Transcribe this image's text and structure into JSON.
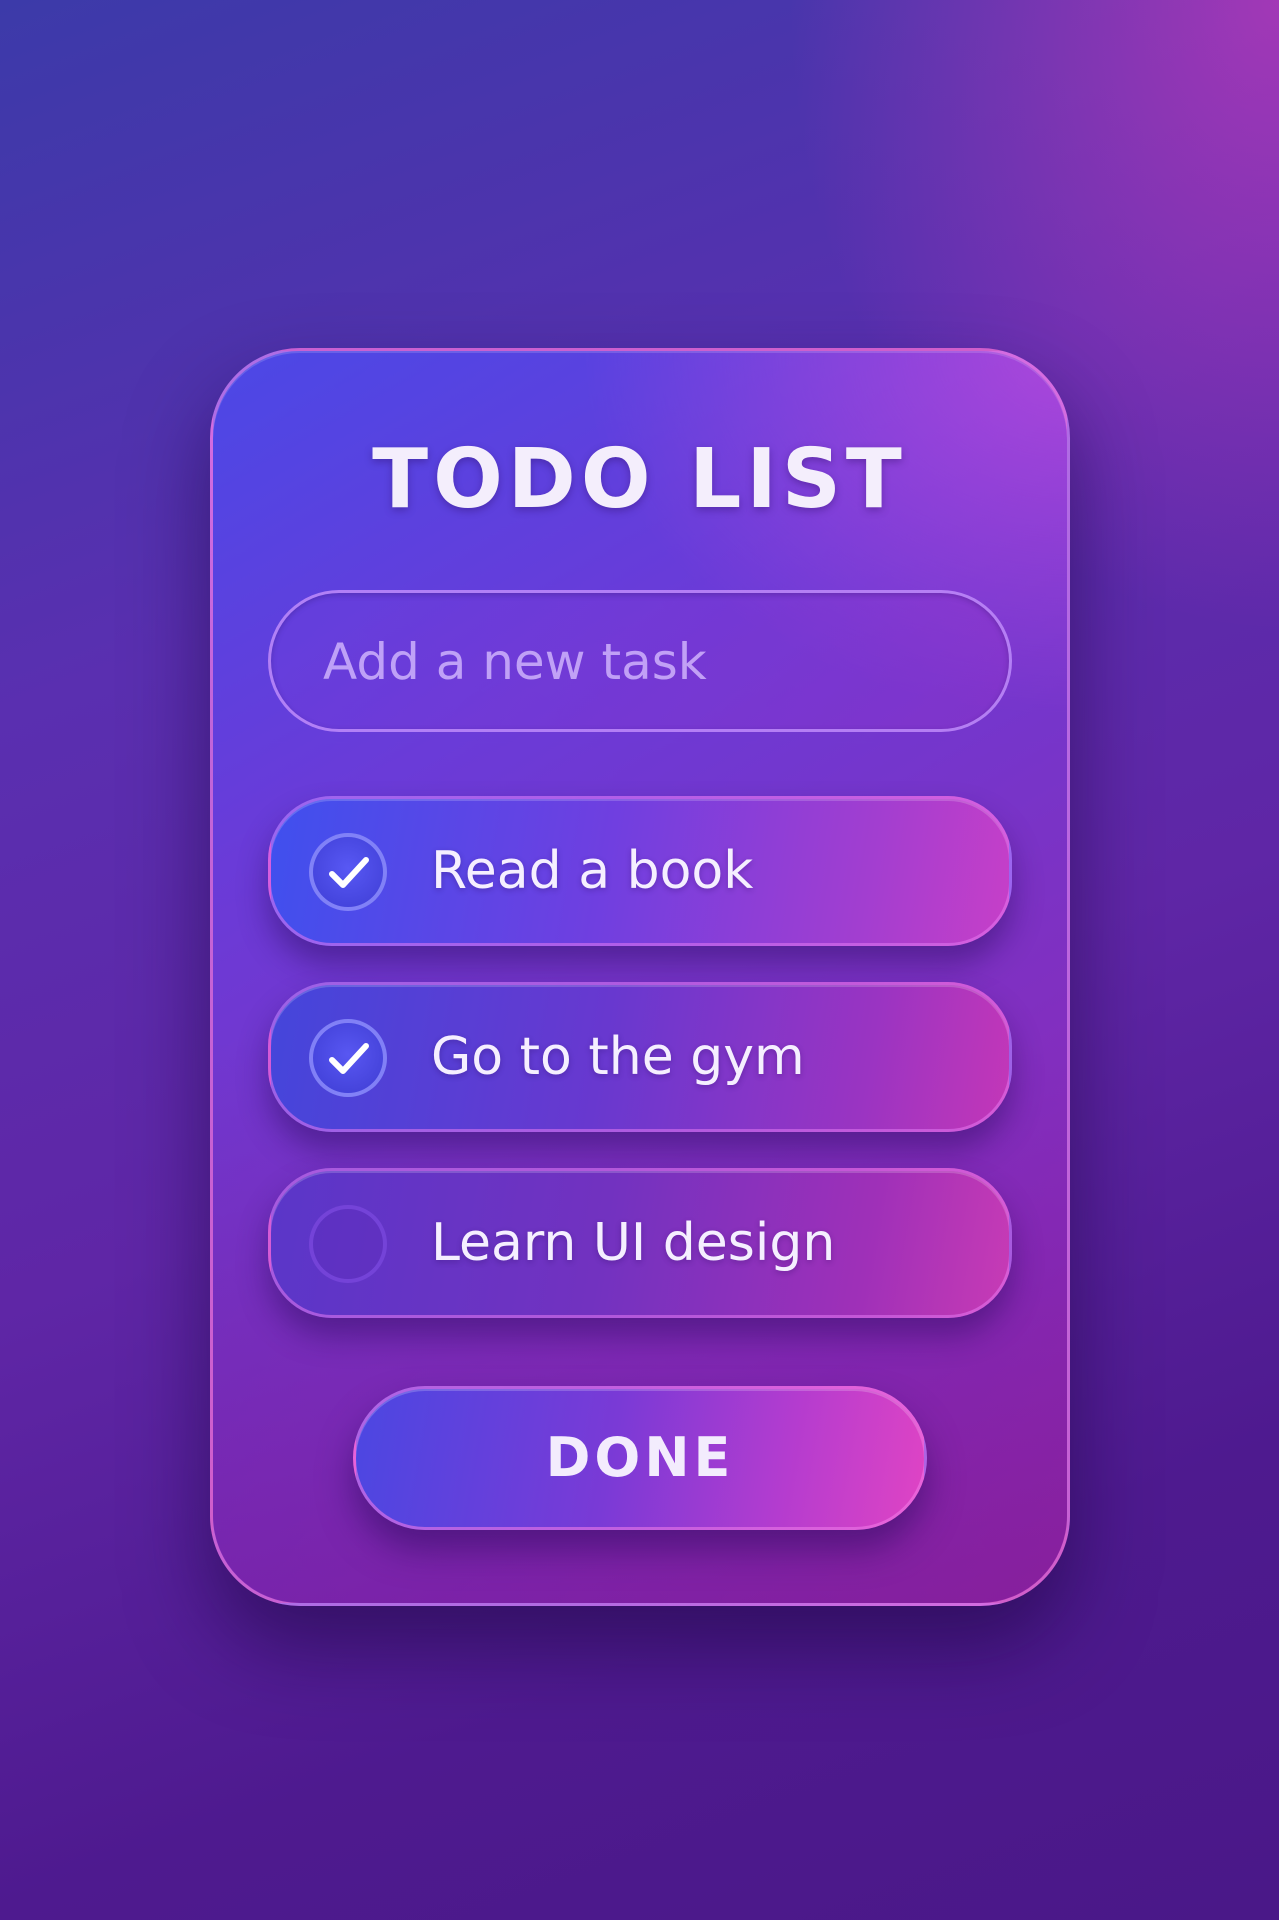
{
  "app": {
    "title": "TODO LIST"
  },
  "new_task": {
    "placeholder": "Add a new task",
    "value": ""
  },
  "tasks": [
    {
      "label": "Read a book",
      "completed": true,
      "icon": "check-icon"
    },
    {
      "label": "Go to the gym",
      "completed": true,
      "icon": "check-icon"
    },
    {
      "label": "Learn UI design",
      "completed": false,
      "icon": "empty-circle"
    }
  ],
  "actions": {
    "done_label": "DONE"
  },
  "colors": {
    "background_start": "#3c3aa9",
    "background_end": "#4a1888",
    "accent_pink": "#e044c4",
    "accent_blue": "#4b47e2",
    "text": "#f5efff"
  }
}
